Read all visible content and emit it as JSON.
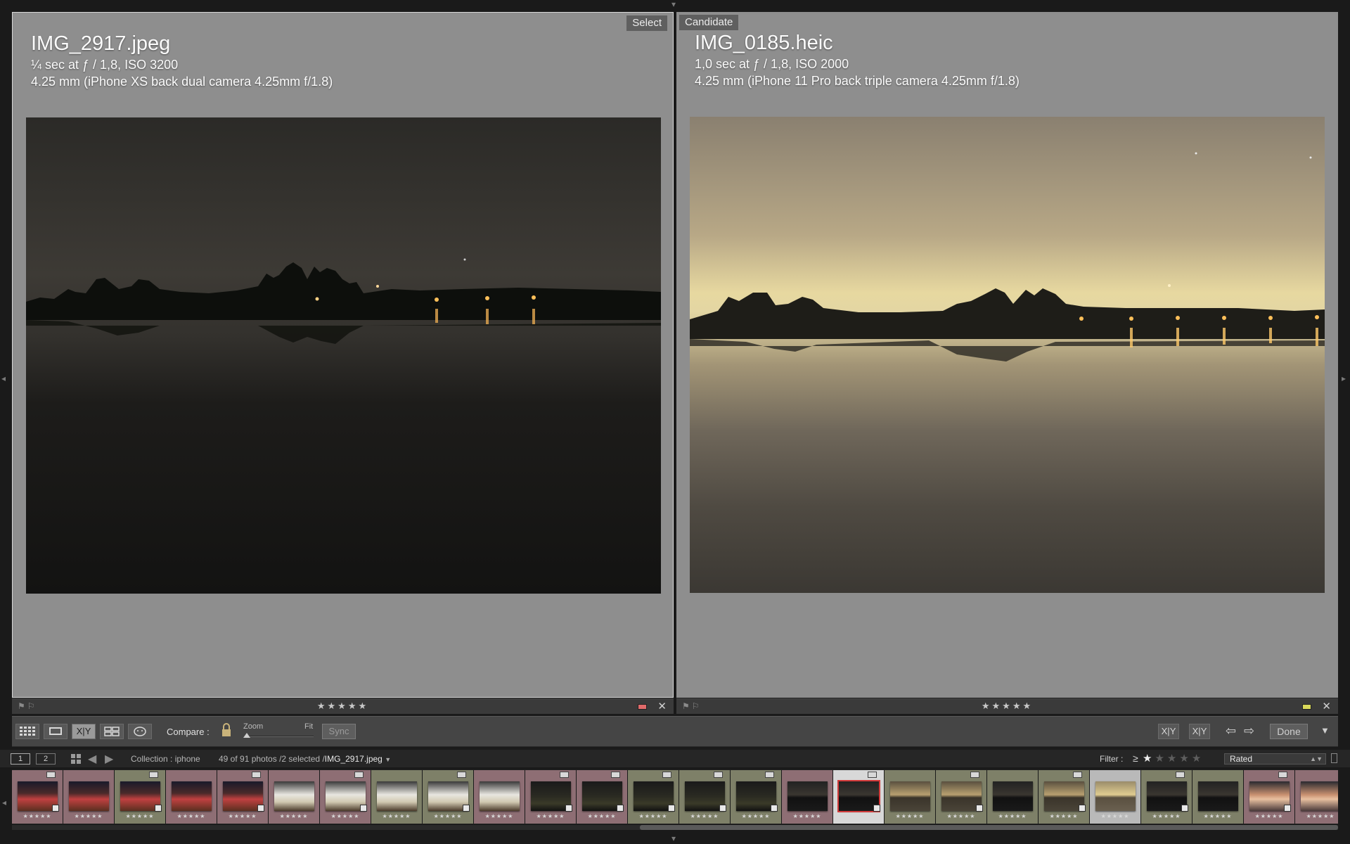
{
  "left_pane": {
    "tag": "Select",
    "filename": "IMG_2917.jpeg",
    "exposure": "¼ sec at ƒ / 1,8, ISO 3200",
    "lens": "4.25 mm (iPhone XS back dual camera 4.25mm f/1.8)",
    "rating_stars": "★★★★★",
    "label_color": "#e06a6a"
  },
  "right_pane": {
    "tag": "Candidate",
    "filename": "IMG_0185.heic",
    "exposure": "1,0 sec at ƒ / 1,8, ISO 2000",
    "lens": "4.25 mm (iPhone 11 Pro back triple camera 4.25mm f/1.8)",
    "rating_stars": "★★★★★",
    "label_color": "#d8d85a"
  },
  "toolbar": {
    "compare_label": "Compare :",
    "zoom_label": "Zoom",
    "fit_label": "Fit",
    "sync_label": "Sync",
    "done_label": "Done",
    "xy_label": "X|Y"
  },
  "filmbar": {
    "monitor_1": "1",
    "monitor_2": "2",
    "collection": "Collection : iphone",
    "count": "49 of 91 photos /2 selected /",
    "current_file": "IMG_2917.jpeg",
    "filter_label": "Filter :",
    "filter_operator": "≥",
    "filter_rating": 1,
    "filter_mode": "Rated"
  },
  "filmstrip": {
    "thumbnails": [
      {
        "label": "pink",
        "tone": "night-city",
        "stars": "★★★★★"
      },
      {
        "label": "pink",
        "tone": "night-city",
        "stars": "★★★★★"
      },
      {
        "label": "green",
        "tone": "night-city",
        "stars": "★★★★★"
      },
      {
        "label": "pink",
        "tone": "night-city",
        "stars": "★★★★★"
      },
      {
        "label": "pink",
        "tone": "night-city",
        "stars": "★★★★★"
      },
      {
        "label": "pink",
        "tone": "tent",
        "stars": "★★★★★"
      },
      {
        "label": "pink",
        "tone": "tent",
        "stars": "★★★★★"
      },
      {
        "label": "green",
        "tone": "tent",
        "stars": "★★★★★"
      },
      {
        "label": "green",
        "tone": "tent",
        "stars": "★★★★★"
      },
      {
        "label": "pink",
        "tone": "tent",
        "stars": "★★★★★"
      },
      {
        "label": "pink",
        "tone": "dark",
        "stars": "★★★★★"
      },
      {
        "label": "pink",
        "tone": "dark",
        "stars": "★★★★★"
      },
      {
        "label": "green",
        "tone": "dark",
        "stars": "★★★★★"
      },
      {
        "label": "green",
        "tone": "dark",
        "stars": "★★★★★"
      },
      {
        "label": "green",
        "tone": "dark",
        "stars": "★★★★★"
      },
      {
        "label": "pink",
        "tone": "lake-dark",
        "stars": "★★★★★"
      },
      {
        "label": "selected",
        "tone": "lake-dark",
        "stars": "★★★★★"
      },
      {
        "label": "green",
        "tone": "lake-warm",
        "stars": "★★★★★"
      },
      {
        "label": "green",
        "tone": "lake-warm",
        "stars": "★★★★★"
      },
      {
        "label": "green",
        "tone": "lake-dark",
        "stars": "★★★★★"
      },
      {
        "label": "green",
        "tone": "lake-warm",
        "stars": "★★★★★"
      },
      {
        "label": "selected2",
        "tone": "lake-bright",
        "stars": "★★★★★"
      },
      {
        "label": "green",
        "tone": "lake-dark",
        "stars": "★★★★★"
      },
      {
        "label": "green",
        "tone": "lake-dark",
        "stars": "★★★★★"
      },
      {
        "label": "pink",
        "tone": "portrait",
        "stars": "★★★★★"
      },
      {
        "label": "pink",
        "tone": "portrait",
        "stars": "★★★★★"
      }
    ]
  },
  "colors": {
    "pink_label_bg": "#8e6e74",
    "green_label_bg": "#7e8068",
    "pane_bg": "#8e8e8e"
  }
}
